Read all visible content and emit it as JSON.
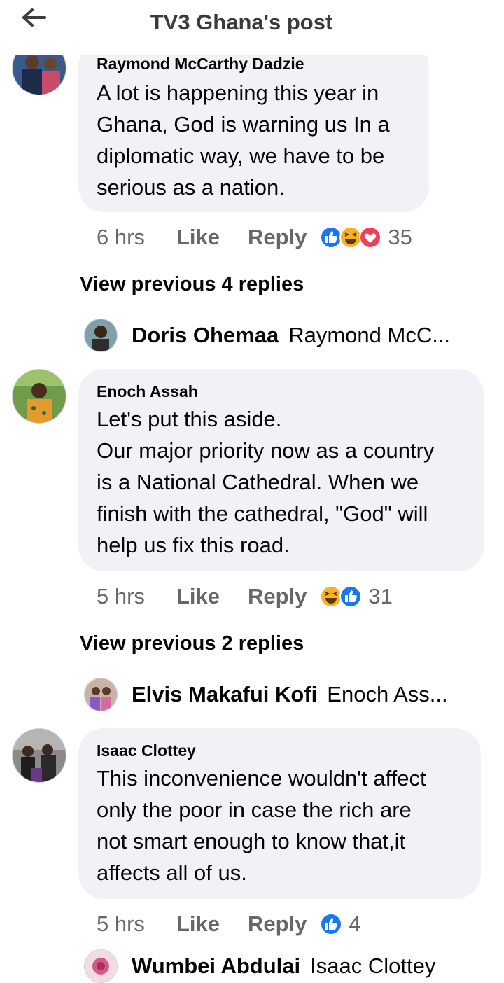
{
  "header": {
    "title": "TV3 Ghana's post",
    "back_icon": "arrow-left-icon"
  },
  "comments": [
    {
      "author": "Raymond McCarthy Dadzie",
      "text": "A lot is happening  this year in\nGhana, God is warning us In a\ndiplomatic way, we have to be\nserious as a nation.",
      "time": "6 hrs",
      "like": "Like",
      "reply": "Reply",
      "reactions": [
        "like-reaction-icon",
        "haha-reaction-icon",
        "love-reaction-icon"
      ],
      "reaction_count": "35",
      "view_replies": "View previous 4 replies",
      "reply_preview": {
        "name": "Doris Ohemaa",
        "snippet": "Raymond McC..."
      }
    },
    {
      "author": "Enoch Assah",
      "text": "Let's put this aside.\nOur major priority now as a country\nis a National Cathedral. When we\nfinish with the cathedral, \"God\" will\nhelp us fix this road.",
      "time": "5 hrs",
      "like": "Like",
      "reply": "Reply",
      "reactions": [
        "haha-reaction-icon",
        "like-reaction-icon"
      ],
      "reaction_count": "31",
      "view_replies": "View previous 2 replies",
      "reply_preview": {
        "name": "Elvis Makafui Kofi",
        "snippet": "Enoch Ass..."
      }
    },
    {
      "author": "Isaac Clottey",
      "text": "This inconvenience wouldn't affect\nonly the poor in case the rich are\nnot smart enough to know that,it\naffects all of us.",
      "time": "5 hrs",
      "like": "Like",
      "reply": "Reply",
      "reactions": [
        "like-reaction-icon"
      ],
      "reaction_count": "4",
      "reply_preview": {
        "name": "Wumbei Abdulai",
        "snippet": "Isaac Clottey"
      }
    }
  ],
  "colors": {
    "bubble": "#f0f2f5",
    "like_blue": "#1877f2",
    "love_red": "#f33e58",
    "haha_yellow": "#f7b125",
    "meta_gray": "#65676b"
  }
}
